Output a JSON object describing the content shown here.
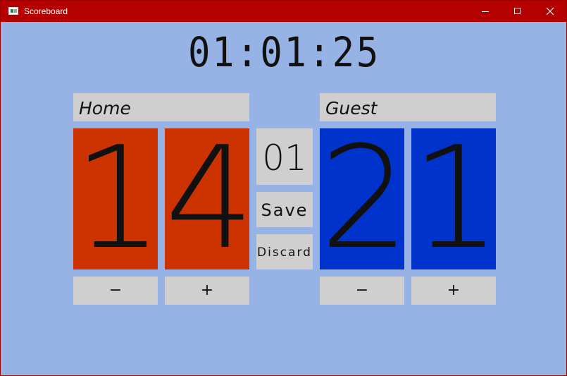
{
  "window": {
    "title": "Scoreboard",
    "controls": {
      "minimize": "minimize-icon",
      "maximize": "maximize-icon",
      "close": "close-icon"
    }
  },
  "clock": "01:01:25",
  "home": {
    "name": "Home",
    "score_tens": "1",
    "score_ones": "4",
    "minus_label": "−",
    "plus_label": "+",
    "color": "#cc3300"
  },
  "guest": {
    "name": "Guest",
    "score_tens": "2",
    "score_ones": "1",
    "minus_label": "−",
    "plus_label": "+",
    "color": "#0033cc"
  },
  "period": "01",
  "buttons": {
    "save": "Save",
    "discard": "Discard"
  },
  "colors": {
    "background": "#97b2e5",
    "titlebar": "#b50000",
    "panel": "#cfcfcf"
  }
}
